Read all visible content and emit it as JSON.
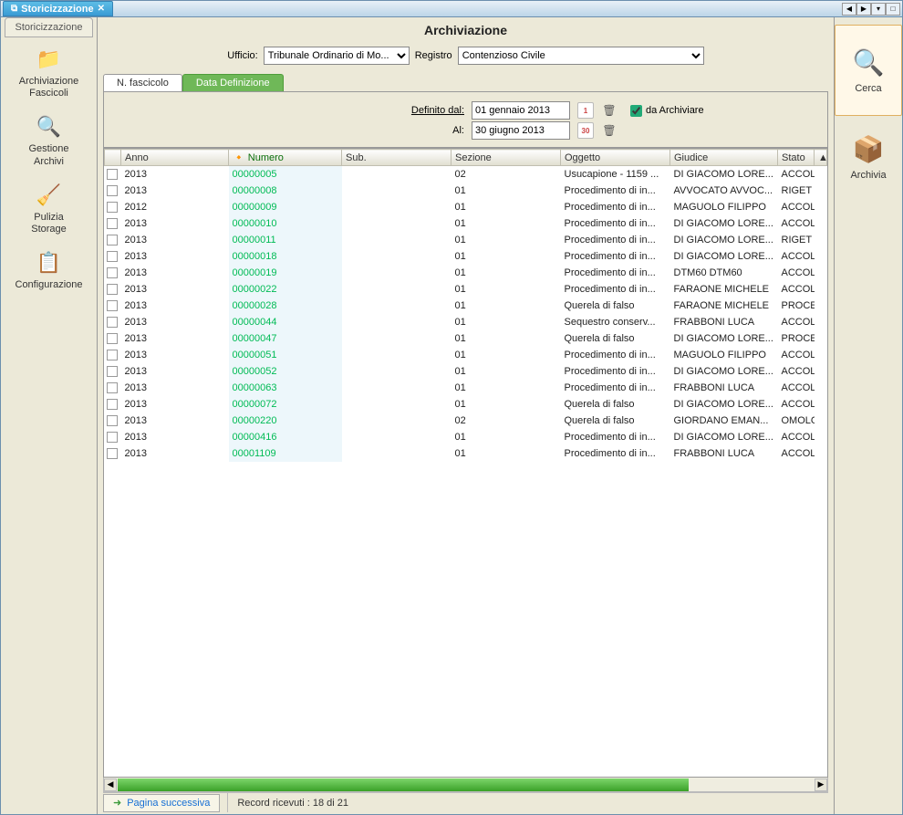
{
  "app_tab": "Storicizzazione",
  "nav_tab": "Storicizzazione",
  "nav": [
    {
      "label": "Archiviazione Fascicoli",
      "icon": "📁"
    },
    {
      "label": "Gestione Archivi",
      "icon": "🔍"
    },
    {
      "label": "Pulizia Storage",
      "icon": "🧹"
    },
    {
      "label": "Configurazione",
      "icon": "📋"
    }
  ],
  "center_title": "Archiviazione",
  "filters": {
    "ufficio_label": "Ufficio:",
    "ufficio_value": "Tribunale Ordinario di Mo...",
    "registro_label": "Registro",
    "registro_value": "Contenzioso Civile"
  },
  "subtabs": {
    "inactive": "N. fascicolo",
    "active": "Data Definizione"
  },
  "dates": {
    "from_label": "Definito dal:",
    "from_value": "01 gennaio 2013",
    "to_label": "Al:",
    "to_value": "30 giugno 2013",
    "chk_label": "da Archiviare",
    "chk_checked": true,
    "cal1": "1",
    "cal2": "30"
  },
  "columns": [
    "Anno",
    "Numero",
    "Sub.",
    "Sezione",
    "Oggetto",
    "Giudice",
    "Stato"
  ],
  "rows": [
    {
      "anno": "2013",
      "numero": "00000005",
      "sub": "",
      "sez": "02",
      "ogg": "Usucapione - 1159 ...",
      "giu": "DI GIACOMO LORE...",
      "stato": "ACCOL"
    },
    {
      "anno": "2013",
      "numero": "00000008",
      "sub": "",
      "sez": "01",
      "ogg": "Procedimento di in...",
      "giu": "AVVOCATO AVVOC...",
      "stato": "RIGET"
    },
    {
      "anno": "2012",
      "numero": "00000009",
      "sub": "",
      "sez": "01",
      "ogg": "Procedimento di in...",
      "giu": "MAGUOLO FILIPPO",
      "stato": "ACCOL"
    },
    {
      "anno": "2013",
      "numero": "00000010",
      "sub": "",
      "sez": "01",
      "ogg": "Procedimento di in...",
      "giu": "DI GIACOMO LORE...",
      "stato": "ACCOL"
    },
    {
      "anno": "2013",
      "numero": "00000011",
      "sub": "",
      "sez": "01",
      "ogg": "Procedimento di in...",
      "giu": "DI GIACOMO LORE...",
      "stato": "RIGET"
    },
    {
      "anno": "2013",
      "numero": "00000018",
      "sub": "",
      "sez": "01",
      "ogg": "Procedimento di in...",
      "giu": "DI GIACOMO LORE...",
      "stato": "ACCOL"
    },
    {
      "anno": "2013",
      "numero": "00000019",
      "sub": "",
      "sez": "01",
      "ogg": "Procedimento di in...",
      "giu": "DTM60 DTM60",
      "stato": "ACCOL"
    },
    {
      "anno": "2013",
      "numero": "00000022",
      "sub": "",
      "sez": "01",
      "ogg": "Procedimento di in...",
      "giu": "FARAONE MICHELE",
      "stato": "ACCOL"
    },
    {
      "anno": "2013",
      "numero": "00000028",
      "sub": "",
      "sez": "01",
      "ogg": "Querela di falso",
      "giu": "FARAONE MICHELE",
      "stato": "PROCE"
    },
    {
      "anno": "2013",
      "numero": "00000044",
      "sub": "",
      "sez": "01",
      "ogg": "Sequestro conserv...",
      "giu": "FRABBONI LUCA",
      "stato": "ACCOL"
    },
    {
      "anno": "2013",
      "numero": "00000047",
      "sub": "",
      "sez": "01",
      "ogg": "Querela di falso",
      "giu": "DI GIACOMO LORE...",
      "stato": "PROCE"
    },
    {
      "anno": "2013",
      "numero": "00000051",
      "sub": "",
      "sez": "01",
      "ogg": "Procedimento di in...",
      "giu": "MAGUOLO FILIPPO",
      "stato": "ACCOL"
    },
    {
      "anno": "2013",
      "numero": "00000052",
      "sub": "",
      "sez": "01",
      "ogg": "Procedimento di in...",
      "giu": "DI GIACOMO LORE...",
      "stato": "ACCOL"
    },
    {
      "anno": "2013",
      "numero": "00000063",
      "sub": "",
      "sez": "01",
      "ogg": "Procedimento di in...",
      "giu": "FRABBONI LUCA",
      "stato": "ACCOL"
    },
    {
      "anno": "2013",
      "numero": "00000072",
      "sub": "",
      "sez": "01",
      "ogg": "Querela di falso",
      "giu": "DI GIACOMO LORE...",
      "stato": "ACCOL"
    },
    {
      "anno": "2013",
      "numero": "00000220",
      "sub": "",
      "sez": "02",
      "ogg": "Querela di falso",
      "giu": "GIORDANO EMAN...",
      "stato": "OMOLO"
    },
    {
      "anno": "2013",
      "numero": "00000416",
      "sub": "",
      "sez": "01",
      "ogg": "Procedimento di in...",
      "giu": "DI GIACOMO LORE...",
      "stato": "ACCOL"
    },
    {
      "anno": "2013",
      "numero": "00001109",
      "sub": "",
      "sez": "01",
      "ogg": "Procedimento di in...",
      "giu": "FRABBONI LUCA",
      "stato": "ACCOL"
    }
  ],
  "pager": {
    "next_label": "Pagina successiva",
    "record_info": "Record ricevuti : 18 di 21"
  },
  "actions": {
    "cerca": "Cerca",
    "archivia": "Archivia"
  }
}
